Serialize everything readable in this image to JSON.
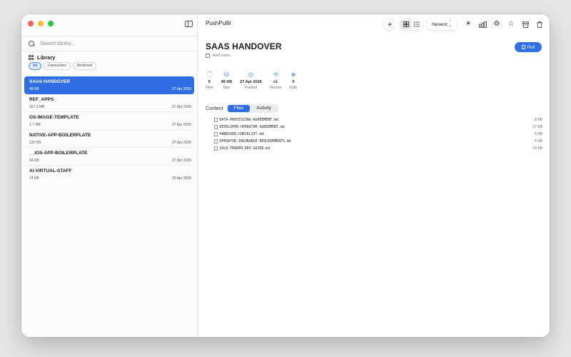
{
  "app": {
    "title": "PushPullit"
  },
  "window": {
    "traffic_colors": [
      "#fe5f57",
      "#febc2e",
      "#28c840"
    ]
  },
  "sidebar": {
    "search_placeholder": "Search library...",
    "library_title": "Library",
    "filters": [
      {
        "label": "All",
        "active": true
      },
      {
        "label": "Favourites",
        "active": false
      },
      {
        "label": "Archived",
        "active": false
      }
    ],
    "items": [
      {
        "name": "SAAS HANDOVER",
        "size": "49 KB",
        "date": "27 Apr 2026",
        "selected": true
      },
      {
        "name": "REF_APPS",
        "size": "167.0 MB",
        "date": "27 Apr 2026",
        "selected": false
      },
      {
        "name": "OS-IMAGE-TEMPLATE",
        "size": "1.7 MB",
        "date": "27 Apr 2026",
        "selected": false
      },
      {
        "name": "NATIVE-APP-BOILERPLATE",
        "size": "120 KB",
        "date": "27 Apr 2026",
        "selected": false
      },
      {
        "name": "__IOS-APP-BOILERPLATE",
        "size": "94 KB",
        "date": "27 Apr 2026",
        "selected": false
      },
      {
        "name": "AI-VIRTUAL-STAFF",
        "size": "74 KB",
        "date": "26 Apr 2026",
        "selected": false
      }
    ]
  },
  "toolbar": {
    "sort_label": "Newest",
    "icons": [
      "plus-icon",
      "grid-view-icon",
      "list-view-icon",
      "sun-icon",
      "chart-icon",
      "gear-icon",
      "star-icon",
      "archive-icon",
      "trash-icon"
    ]
  },
  "detail": {
    "title": "SAAS HANDOVER",
    "notes_placeholder": "Add notes",
    "pull_label": "Pull",
    "stats": [
      {
        "value": "5",
        "label": "Files",
        "icon": "file-icon"
      },
      {
        "value": "49 KB",
        "label": "Size",
        "icon": "drive-icon"
      },
      {
        "value": "27 Apr 2026",
        "label": "Pushed",
        "icon": "clock-icon"
      },
      {
        "value": "v1",
        "label": "Version",
        "icon": "cycle-icon"
      },
      {
        "value": "0",
        "label": "Pulls",
        "icon": "download-icon"
      }
    ],
    "content_label": "Content",
    "tabs": [
      {
        "label": "Files",
        "active": true
      },
      {
        "label": "Activity",
        "active": false
      }
    ],
    "files": [
      {
        "name": "DATA-PROCESSING-AGREEMENT.md",
        "size": "8 KB"
      },
      {
        "name": "DEVELOPER-OPERATOR-AGREEMENT.md",
        "size": "17 KB"
      },
      {
        "name": "HANDOVER-CHECKLIST.md",
        "size": "6 KB"
      },
      {
        "name": "OPERATOR-INSURANCE-REQUIREMENTS.md",
        "size": "5 KB"
      },
      {
        "name": "SOLE-TRADER-DEV-GUIDE.md",
        "size": "14 KB"
      }
    ]
  }
}
